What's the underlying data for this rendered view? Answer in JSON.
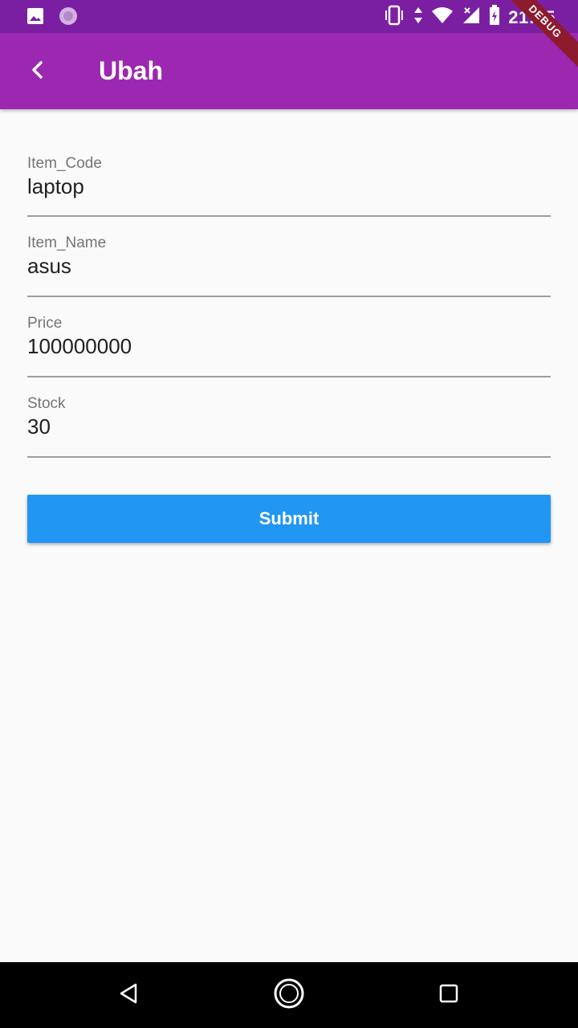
{
  "status_bar": {
    "time": "21:05",
    "icons": [
      "image-icon",
      "app-badge-icon",
      "vibrate-icon",
      "data-arrows-icon",
      "wifi-icon",
      "signal-icon",
      "battery-charging-icon"
    ]
  },
  "debug_banner": "DEBUG",
  "app_bar": {
    "title": "Ubah",
    "back_icon": "chevron-left-icon"
  },
  "form": {
    "fields": [
      {
        "label": "Item_Code",
        "value": "laptop"
      },
      {
        "label": "Item_Name",
        "value": "asus"
      },
      {
        "label": "Price",
        "value": "100000000"
      },
      {
        "label": "Stock",
        "value": "30"
      }
    ],
    "submit_label": "Submit"
  },
  "colors": {
    "status_bar": "#7b1fa2",
    "app_bar": "#9c27b0",
    "button": "#2196f3",
    "background": "#fafafa"
  },
  "nav_bar": {
    "icons": [
      "back-triangle-icon",
      "home-circle-icon",
      "recents-square-icon"
    ]
  }
}
